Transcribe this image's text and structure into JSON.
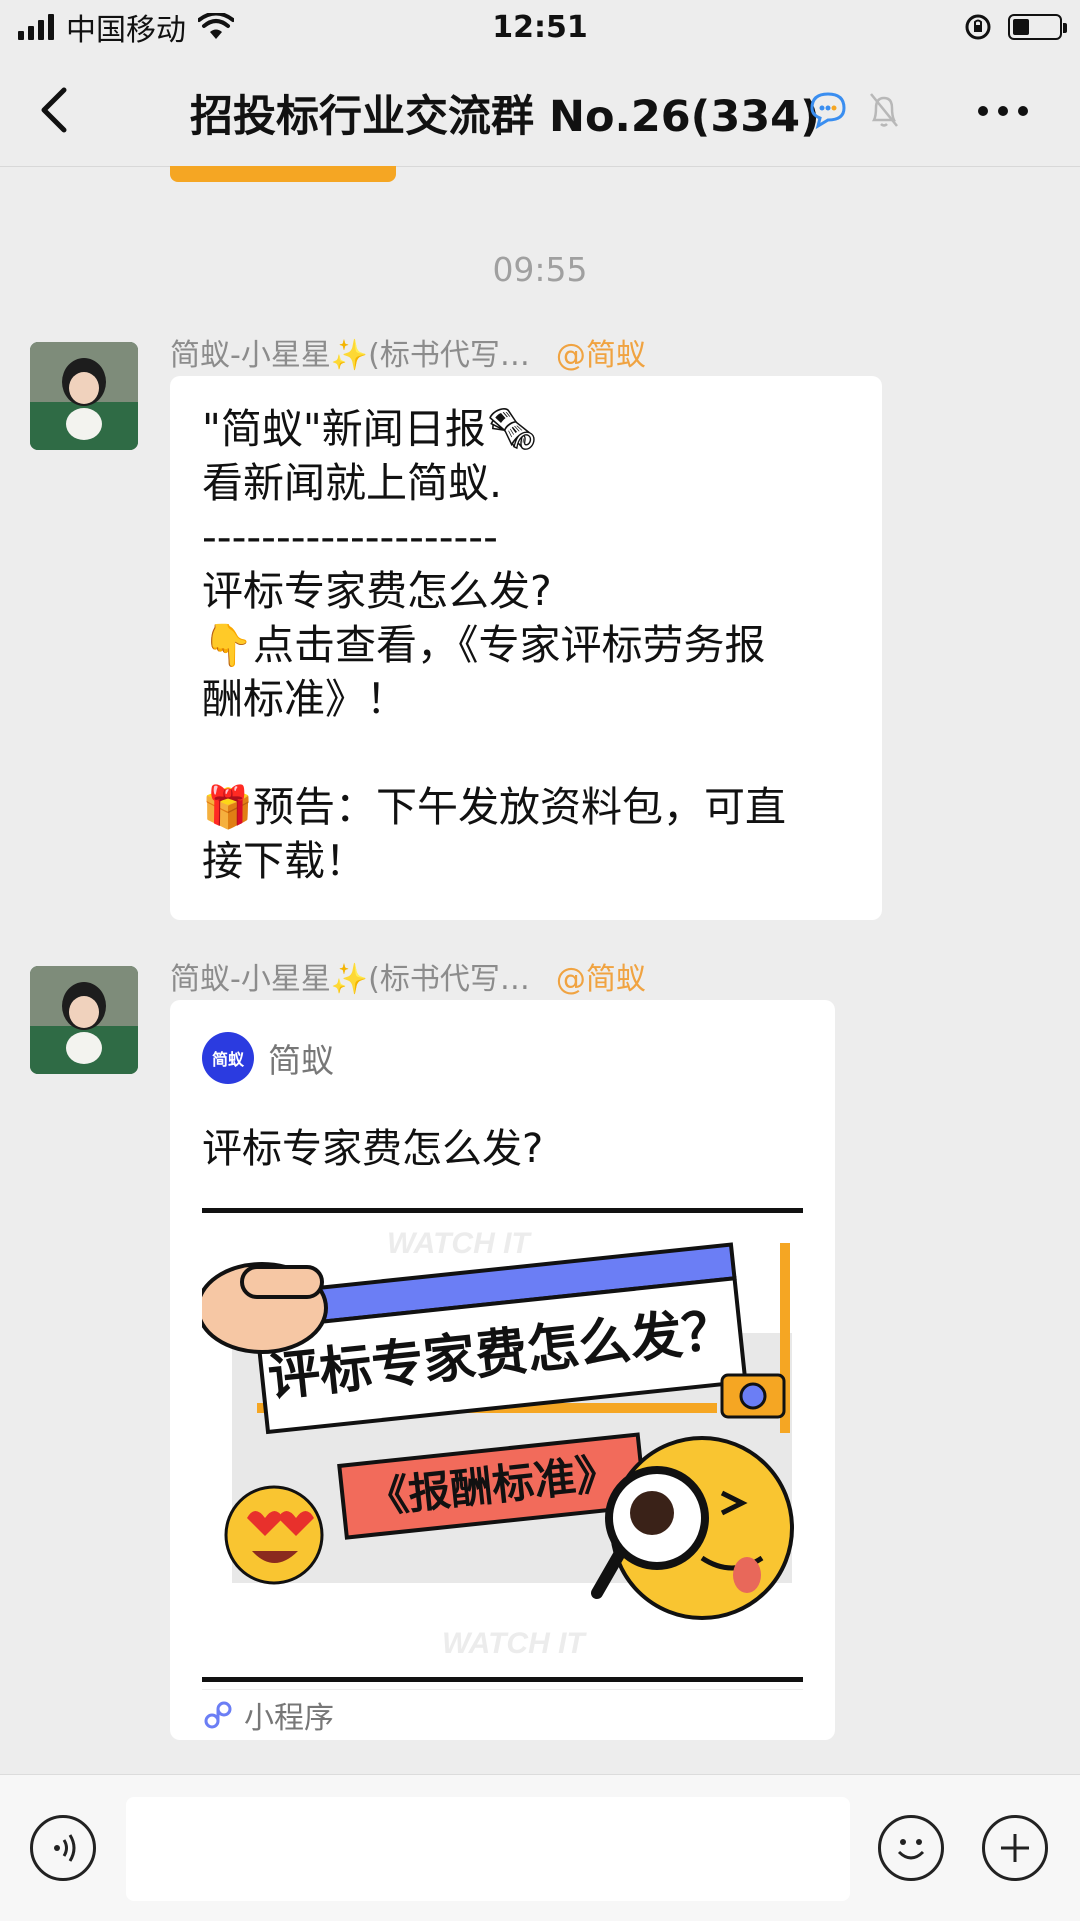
{
  "status_bar": {
    "carrier": "中国移动",
    "time": "12:51"
  },
  "nav": {
    "title": "招投标行业交流群 No.26(334)"
  },
  "chat": {
    "timestamp": "09:55",
    "messages": [
      {
        "sender": "简蚁-小星星✨(标书代写…",
        "mention": "@简蚁",
        "lines": [
          "\"简蚁\"新闻日报🗞",
          "看新闻就上简蚁.",
          "--------------------",
          "评标专家费怎么发?",
          "👇点击查看，《专家评标劳务报",
          "酬标准》！",
          " ",
          "🎁预告：下午发放资料包，可直",
          "接下载！"
        ]
      },
      {
        "sender": "简蚁-小星星✨(标书代写…",
        "mention": "@简蚁",
        "mini_program": {
          "logo_text": "简蚁",
          "app_name": "简蚁",
          "title": "评标专家费怎么发?",
          "banner_headline": "评标专家费怎么发？",
          "banner_subline": "《报酬标准》",
          "watermark": "WATCH IT",
          "footer_label": "小程序"
        }
      }
    ]
  },
  "colors": {
    "background": "#ededed",
    "mention": "#f0a341",
    "banner_blue": "#6b7ef5",
    "banner_red": "#f26b5b",
    "banner_orange": "#f5a623"
  },
  "icons": [
    "signal-icon",
    "wifi-icon",
    "orientation-lock-icon",
    "battery-icon",
    "back-icon",
    "group-chat-icon",
    "mute-icon",
    "more-icon",
    "voice-icon",
    "emoji-icon",
    "plus-icon",
    "mini-program-icon"
  ]
}
